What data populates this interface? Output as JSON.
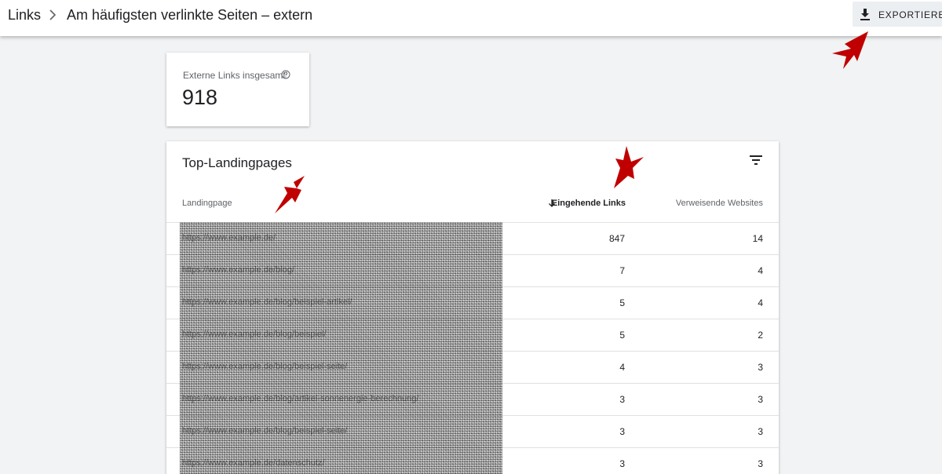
{
  "header": {
    "breadcrumb_root": "Links",
    "title": "Am häufigsten verlinkte Seiten – extern",
    "export_label": "EXPORTIEREN"
  },
  "stat": {
    "label": "Externe Links insgesamt",
    "value": "918"
  },
  "table": {
    "title": "Top-Landingpages",
    "columns": {
      "landingpage": "Landingpage",
      "incoming_links": "Eingehende Links",
      "referring_sites": "Verweisende Websites"
    },
    "rows": [
      {
        "url": "https://www.example.de/",
        "links": "847",
        "sites": "14"
      },
      {
        "url": "https://www.example.de/blog/",
        "links": "7",
        "sites": "4"
      },
      {
        "url": "https://www.example.de/blog/beispiel-artikel/",
        "links": "5",
        "sites": "4"
      },
      {
        "url": "https://www.example.de/blog/beispiel/",
        "links": "5",
        "sites": "2"
      },
      {
        "url": "https://www.example.de/blog/beispiel-seite/",
        "links": "4",
        "sites": "3"
      },
      {
        "url": "https://www.example.de/blog/artikel-sonnenergie-berechnung/",
        "links": "3",
        "sites": "3"
      },
      {
        "url": "https://www.example.de/blog/beispiel-seite/",
        "links": "3",
        "sites": "3"
      },
      {
        "url": "https://www.example.de/datenschutz/",
        "links": "3",
        "sites": "3"
      }
    ]
  },
  "colors": {
    "annotation_arrow": "#c00000",
    "accent": "#202124"
  }
}
